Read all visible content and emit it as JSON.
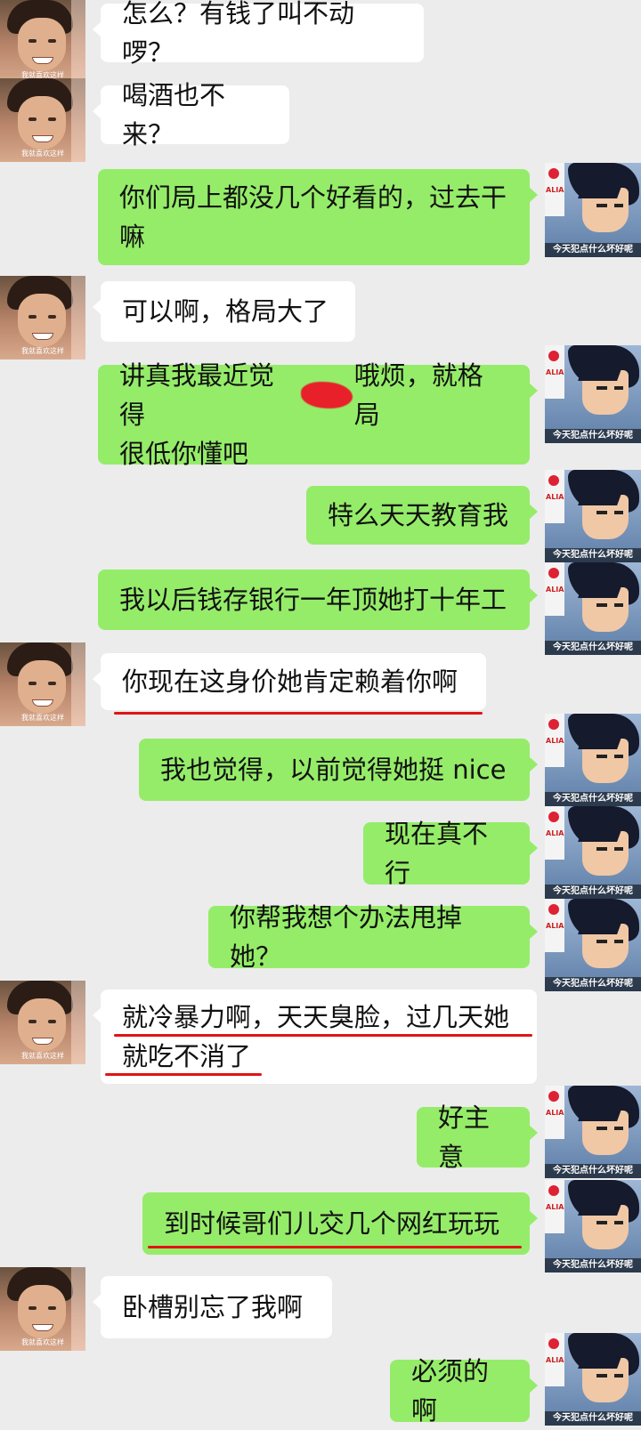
{
  "left_avatar_caption": "我就喜欢这样",
  "right_avatar_caption": "今天犯点什么坏好呢",
  "right_avatar_sign": "ALIA",
  "colors": {
    "background": "#ececec",
    "left_bubble": "#ffffff",
    "right_bubble": "#95ec69",
    "underline": "#e01414"
  },
  "messages": [
    {
      "side": "left",
      "lines": [
        "怎么？有钱了叫不动啰？"
      ]
    },
    {
      "side": "left",
      "lines": [
        "喝酒也不来？"
      ]
    },
    {
      "side": "right",
      "lines": [
        "你们局上都没几个好看的，过去干",
        "嘛"
      ]
    },
    {
      "side": "left",
      "lines": [
        "可以啊，格局大了"
      ]
    },
    {
      "side": "right",
      "lines": [
        "讲真我最近觉得",
        "哦烦，就格局",
        "很低你懂吧"
      ]
    },
    {
      "side": "right",
      "lines": [
        "特么天天教育我"
      ]
    },
    {
      "side": "right",
      "lines": [
        "我以后钱存银行一年顶她打十年工"
      ]
    },
    {
      "side": "left",
      "lines": [
        "你现在这身价她肯定赖着你啊"
      ]
    },
    {
      "side": "right",
      "lines": [
        "我也觉得，以前觉得她挺 nice"
      ]
    },
    {
      "side": "right",
      "lines": [
        "现在真不行"
      ]
    },
    {
      "side": "right",
      "lines": [
        "你帮我想个办法甩掉她？"
      ]
    },
    {
      "side": "left",
      "lines": [
        "就冷暴力啊，天天臭脸，过几天她",
        "就吃不消了"
      ]
    },
    {
      "side": "right",
      "lines": [
        "好主意"
      ]
    },
    {
      "side": "right",
      "lines": [
        "到时候哥们儿交几个网红玩玩"
      ]
    },
    {
      "side": "left",
      "lines": [
        "卧槽别忘了我啊"
      ]
    },
    {
      "side": "right",
      "lines": [
        "必须的啊"
      ]
    }
  ]
}
